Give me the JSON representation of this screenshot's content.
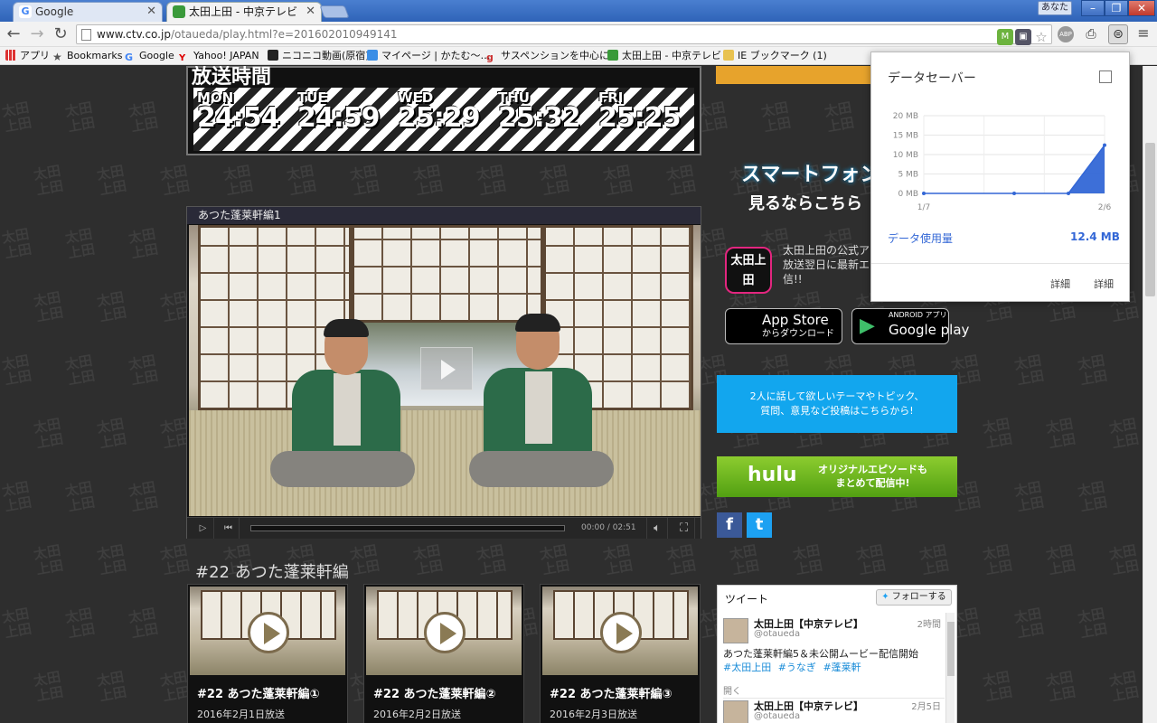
{
  "browser": {
    "tabs": [
      {
        "label": "Google",
        "active": false
      },
      {
        "label": "太田上田 - 中京テレビ",
        "active": true
      }
    ],
    "user_badge": "あなた",
    "window_controls": {
      "minimize": "–",
      "restore": "❐",
      "close": "✕"
    },
    "url_host": "www.ctv.co.jp",
    "url_path": "/otaueda/play.html?e=201602010949141",
    "bookmarks": [
      "アプリ",
      "Bookmarks",
      "Google",
      "Yahoo! JAPAN",
      "ニコニコ動画(原宿)",
      "マイページ | かたむ〜…",
      "サスペンションを中心に…",
      "太田上田 - 中京テレビ",
      "IE ブックマーク (1)"
    ]
  },
  "schedule": {
    "title": "放送時間",
    "days": [
      {
        "day": "MON",
        "time": "24:54"
      },
      {
        "day": "TUE",
        "time": "24:59"
      },
      {
        "day": "WED",
        "time": "25:29"
      },
      {
        "day": "THU",
        "time": "25:32"
      },
      {
        "day": "FRI",
        "time": "25:25"
      }
    ]
  },
  "player": {
    "title": "あつた蓬莱軒編1",
    "time_display": "00:00 / 02:51",
    "progress": 0.0
  },
  "section": {
    "title": "#22 あつた蓬莱軒編",
    "episodes": [
      {
        "title": "#22 あつた蓬莱軒編①",
        "date": "2016年2月1日放送"
      },
      {
        "title": "#22 あつた蓬莱軒編②",
        "date": "2016年2月2日放送"
      },
      {
        "title": "#22 あつた蓬莱軒編③",
        "date": "2016年2月3日放送"
      }
    ]
  },
  "sidebar": {
    "promo_line1": "スマートフォン",
    "promo_line2": "見るならこちら",
    "app_icon_text": "太田上田",
    "app_text": "太田上田の公式ア 放送翌日に最新エ 信!!",
    "app_store": {
      "line1": "App Store",
      "line2": "からダウンロード"
    },
    "google_play": {
      "line1": "Google play",
      "line2": "ANDROID アプリ"
    },
    "request_box": "2人に話して欲しいテーマやトピック、\n質問、意見など投稿はこちらから!",
    "hulu": {
      "logo": "hulu",
      "text": "オリジナルエピソードも\nまとめて配信中!"
    },
    "facebook": "f",
    "twitter": "t"
  },
  "tweets": {
    "label": "ツイート",
    "follow": "フォローする",
    "items": [
      {
        "name": "太田上田【中京テレビ】",
        "handle": "@otaueda",
        "when": "2時間",
        "text": "あつた蓬莱軒編5＆未公開ムービー配信開始",
        "tags": [
          "#太田上田",
          "#うなぎ",
          "#蓬莱軒"
        ],
        "open": "開く"
      },
      {
        "name": "太田上田【中京テレビ】",
        "handle": "@otaueda",
        "when": "2月5日"
      }
    ]
  },
  "data_saver": {
    "title": "データセーバー",
    "enabled": false,
    "usage_label": "データ使用量",
    "usage_value": "12.4 MB",
    "details_links": [
      "詳細",
      "詳細"
    ],
    "accent_color": "#3367d6"
  },
  "chart_data": {
    "type": "area",
    "title": "",
    "x_labels": [
      "1/7",
      "2/6"
    ],
    "y_ticks": [
      "20 MB",
      "15 MB",
      "10 MB",
      "5 MB",
      "0 MB"
    ],
    "ylim": [
      0,
      20
    ],
    "points": [
      {
        "x": 0,
        "y": 0
      },
      {
        "x": 0.5,
        "y": 0
      },
      {
        "x": 0.8,
        "y": 0
      },
      {
        "x": 1.0,
        "y": 12.4
      }
    ]
  }
}
